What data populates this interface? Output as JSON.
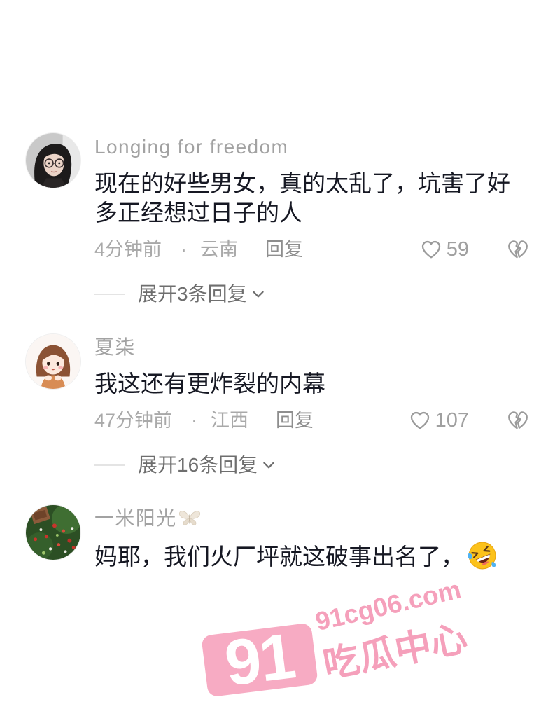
{
  "comments": [
    {
      "avatar_icon": "woman-with-glasses-avatar",
      "username": "Longing for freedom",
      "content": "现在的好些男女，真的太乱了，坑害了好多正经想过日子的人",
      "time": "4分钟前",
      "separator": "·",
      "location": "云南",
      "reply_label": "回复",
      "likes": "59",
      "like_icon": "heart-outline-icon",
      "dislike_icon": "broken-heart-icon",
      "expand_label": "展开3条回复",
      "expand_icon": "chevron-down-icon"
    },
    {
      "avatar_icon": "cartoon-girl-avatar",
      "username": "夏柒",
      "content": "我这还有更炸裂的内幕",
      "time": "47分钟前",
      "separator": "·",
      "location": "江西",
      "reply_label": "回复",
      "likes": "107",
      "like_icon": "heart-outline-icon",
      "dislike_icon": "broken-heart-icon",
      "expand_label": "展开16条回复",
      "expand_icon": "chevron-down-icon"
    },
    {
      "avatar_icon": "garden-plants-avatar",
      "username": "一米阳光",
      "username_icon": "butterfly-icon",
      "content": "妈耶，我们火厂坪就这破事出名了，",
      "content_icon": "rolling-on-the-floor-laughing-emoji-icon"
    }
  ],
  "watermark": {
    "badge": "91",
    "domain": "91cg06.com",
    "name": "吃瓜中心"
  },
  "colors": {
    "background": "#ffffff",
    "text": "#161823",
    "username": "#a2a2a2",
    "meta": "#a9a9a9",
    "expand": "#6e6e6e",
    "watermark_pink": "#f5a0bb"
  }
}
